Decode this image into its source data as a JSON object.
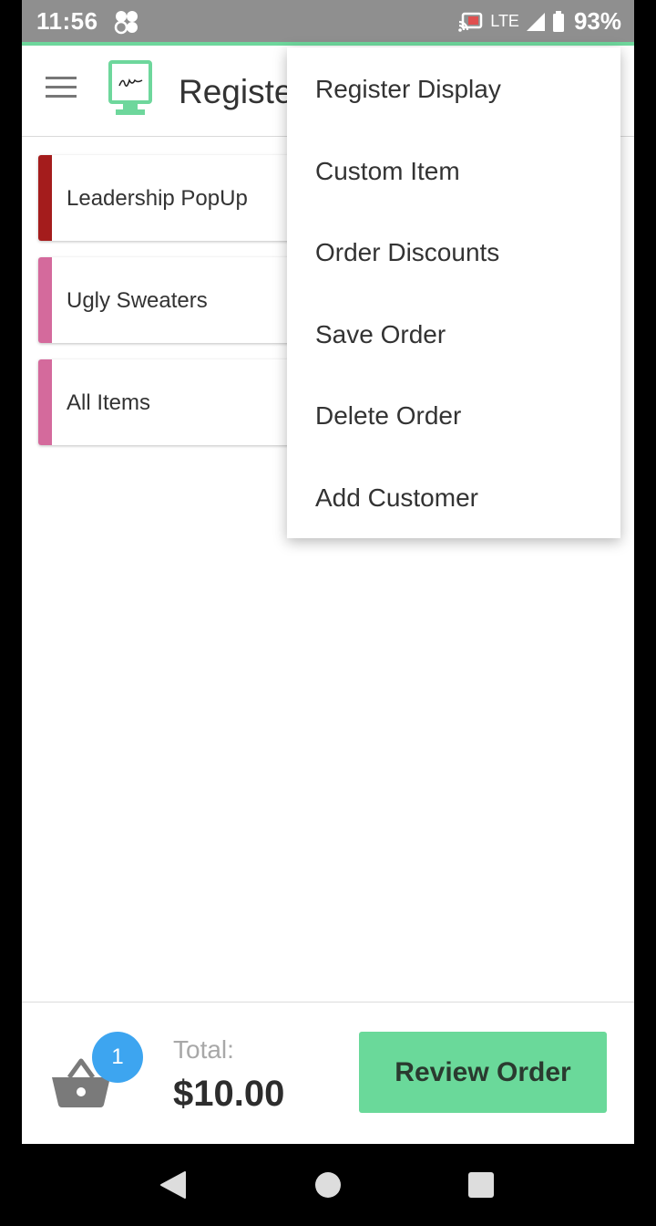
{
  "status_bar": {
    "time": "11:56",
    "network": "LTE",
    "battery": "93%"
  },
  "toolbar": {
    "title": "Registe"
  },
  "categories": [
    {
      "label": "Leadership PopUp",
      "color": "#a41c1c"
    },
    {
      "label": "Ugly Sweaters",
      "color": "#d46a9c"
    },
    {
      "label": "All Items",
      "color": "#d46a9c"
    }
  ],
  "menu": {
    "items": [
      "Register Display",
      "Custom Item",
      "Order Discounts",
      "Save Order",
      "Delete Order",
      "Add Customer"
    ]
  },
  "footer": {
    "cart_count": "1",
    "total_label": "Total:",
    "total_value": "$10.00",
    "review_button": "Review Order"
  },
  "colors": {
    "accent_green": "#6ad99a",
    "badge_blue": "#3da5f0",
    "status_bar": "#8f8f8f"
  },
  "icons": {
    "menu": "hamburger-menu-icon",
    "logo": "register-display-logo",
    "cart": "basket-icon",
    "status": [
      "clover-icon",
      "cast-icon",
      "signal-icon",
      "battery-icon"
    ],
    "nav": [
      "back-icon",
      "home-icon",
      "recent-apps-icon"
    ]
  }
}
